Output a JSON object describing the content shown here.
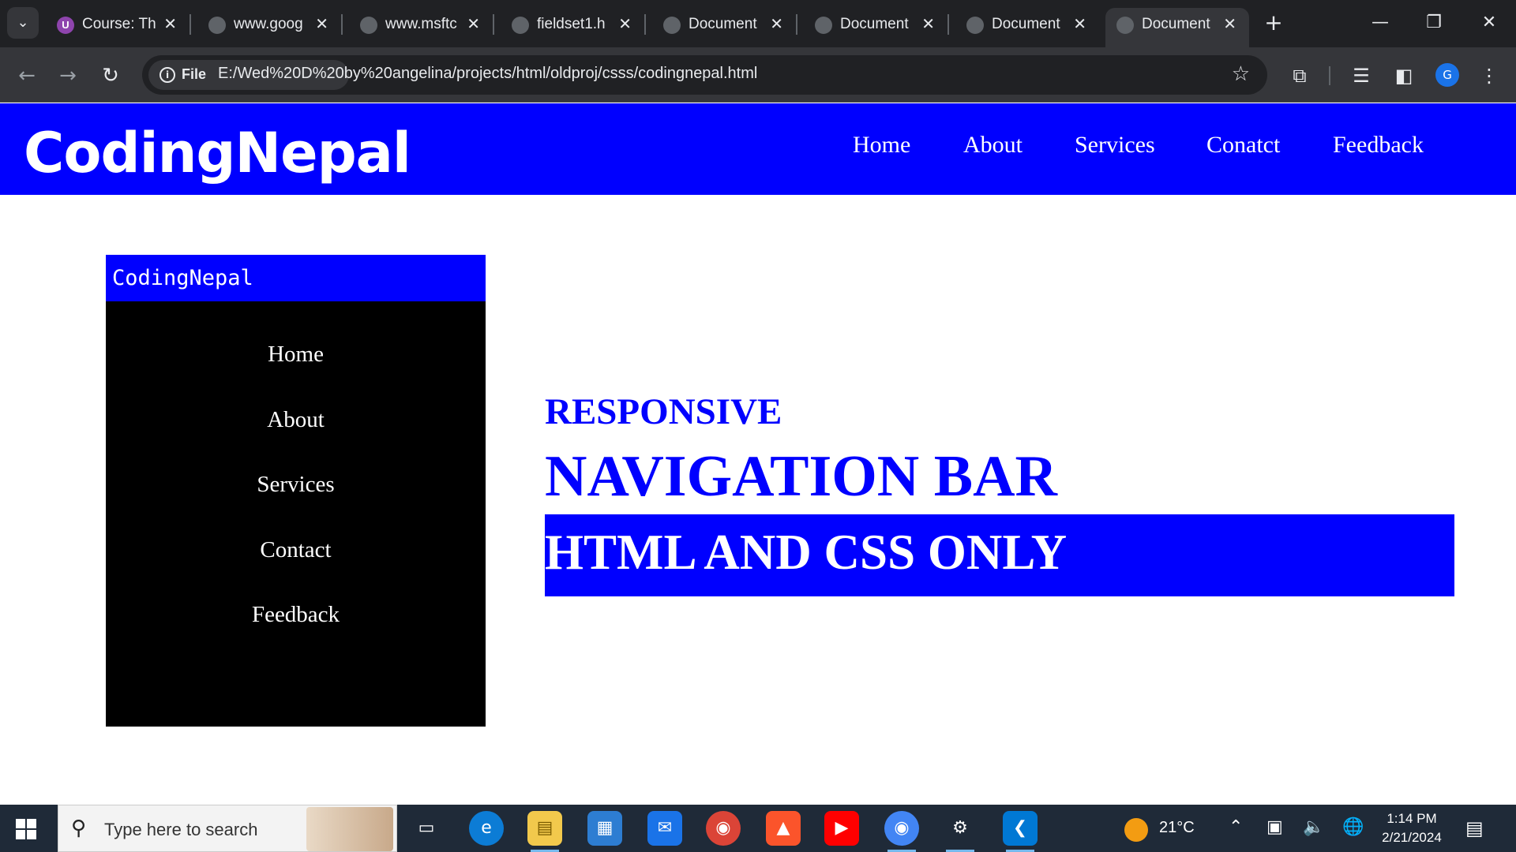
{
  "browser": {
    "tabs": [
      {
        "label": "Course: Th",
        "active": false
      },
      {
        "label": "www.goog",
        "active": false
      },
      {
        "label": "www.msftc",
        "active": false
      },
      {
        "label": "fieldset1.h",
        "active": false
      },
      {
        "label": "Document",
        "active": false
      },
      {
        "label": "Document",
        "active": false
      },
      {
        "label": "Document",
        "active": false
      },
      {
        "label": "Document",
        "active": true
      }
    ],
    "chip_label": "File",
    "url": "E:/Wed%20D%20by%20angelina/projects/html/oldproj/csss/codingnepal.html",
    "profile_initial": "G"
  },
  "site": {
    "logo": "CodingNepal",
    "nav": [
      "Home",
      "About",
      "Services",
      "Conatct",
      "Feedback"
    ],
    "sidebar": {
      "title": "CodingNepal",
      "items": [
        "Home",
        "About",
        "Services",
        "Contact",
        "Feedback"
      ]
    },
    "hero": {
      "line1": "RESPONSIVE",
      "line2": "NAVIGATION BAR",
      "line3": "HTML AND CSS ONLY"
    },
    "colors": {
      "brand": "#0000ff",
      "sidebar_bg": "#000000"
    }
  },
  "taskbar": {
    "search_placeholder": "Type here to search",
    "weather_temp": "21°C",
    "time": "1:14 PM",
    "date": "2/21/2024"
  }
}
